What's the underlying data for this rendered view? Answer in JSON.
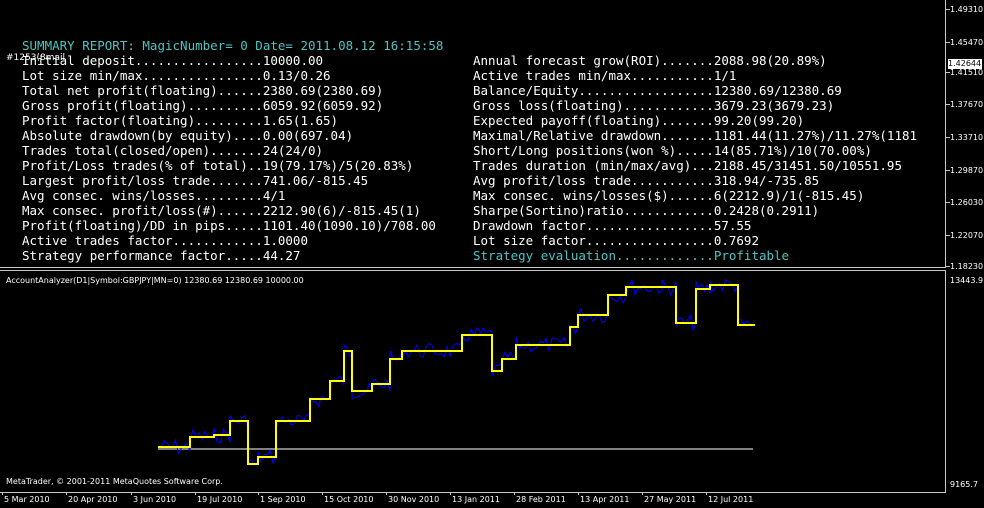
{
  "report": {
    "title": "SUMMARY REPORT: MagicNumber= 0 Date= 2011.08.12 16:15:58",
    "symbol_tag": "#1253(8mail",
    "left_rows": [
      {
        "label": "Initial deposit.................",
        "value": "10000.00"
      },
      {
        "label": "Lot size min/max................",
        "value": "0.13/0.26"
      },
      {
        "label": "Total net profit(floating)......",
        "value": "2380.69(2380.69)"
      },
      {
        "label": "Gross profit(floating)..........",
        "value": "6059.92(6059.92)"
      },
      {
        "label": "Profit factor(floating).........",
        "value": "1.65(1.65)"
      },
      {
        "label": "Absolute drawdown(by equity)....",
        "value": "0.00(697.04)"
      },
      {
        "label": "Trades total(closed/open).......",
        "value": "24(24/0)"
      },
      {
        "label": "Profit/Loss trades(% of total)..",
        "value": "19(79.17%)/5(20.83%)"
      },
      {
        "label": "Largest profit/loss trade.......",
        "value": "741.06/-815.45"
      },
      {
        "label": "Avg consec. wins/losses.........",
        "value": "4/1"
      },
      {
        "label": "Max consec. profit/loss(#)......",
        "value": "2212.90(6)/-815.45(1)"
      },
      {
        "label": "Profit(floating)/DD in pips.....",
        "value": "1101.40(1090.10)/708.00"
      },
      {
        "label": "Active trades factor............",
        "value": "1.0000"
      },
      {
        "label": "Strategy performance factor.....",
        "value": "44.27"
      }
    ],
    "right_rows": [
      {
        "label": "Annual forecast grow(ROI).......",
        "value": "2088.98(20.89%)"
      },
      {
        "label": "Active trades min/max...........",
        "value": "1/1"
      },
      {
        "label": "Balance/Equity..................",
        "value": "12380.69/12380.69"
      },
      {
        "label": "Gross loss(floating)............",
        "value": "3679.23(3679.23)"
      },
      {
        "label": "Expected payoff(floating).......",
        "value": "99.20(99.20)"
      },
      {
        "label": "Maximal/Relative drawdown.......",
        "value": "1181.44(11.27%)/11.27%(1181"
      },
      {
        "label": "Short/Long positions(won %).....",
        "value": "14(85.71%)/10(70.00%)"
      },
      {
        "label": "Trades duration (min/max/avg)...",
        "value": "2188.45/31451.50/10551.95"
      },
      {
        "label": "Avg profit/loss trade...........",
        "value": "318.94/-735.85"
      },
      {
        "label": "Max consec. wins/losses($)......",
        "value": "6(2212.9)/1(-815.45)"
      },
      {
        "label": "Sharpe(Sortino)ratio............",
        "value": "0.2428(0.2911)"
      },
      {
        "label": "Drawdown factor.................",
        "value": "57.55"
      },
      {
        "label": "Lot size factor.................",
        "value": "0.7692"
      },
      {
        "label": "Strategy evaluation.............",
        "value": "Profitable"
      }
    ]
  },
  "price_scale": {
    "labels": [
      "1.49310",
      "1.45470",
      "1.41510",
      "1.37670",
      "1.33710",
      "1.29870",
      "1.26030",
      "1.22070",
      "1.18230"
    ],
    "current": "1.42644"
  },
  "indicator": {
    "label": "AccountAnalyzer(D1|Symbol:GBPJPY|MN=0) 12380.69 12380.69 10000.00",
    "scale_top": "13443.9",
    "scale_bottom": "9165.7",
    "copyright": "MetaTrader, © 2001-2011 MetaQuotes Software Corp.",
    "colors": {
      "balance": "#ffff00",
      "equity": "#0000ff",
      "deposit": "#ffffff"
    }
  },
  "date_axis": {
    "labels": [
      "5 Mar 2010",
      "20 Apr 2010",
      "3 Jun 2010",
      "19 Jul 2010",
      "1 Sep 2010",
      "15 Oct 2010",
      "30 Nov 2010",
      "13 Jan 2011",
      "28 Feb 2011",
      "13 Apr 2011",
      "27 May 2011",
      "12 Jul 2011"
    ]
  }
}
